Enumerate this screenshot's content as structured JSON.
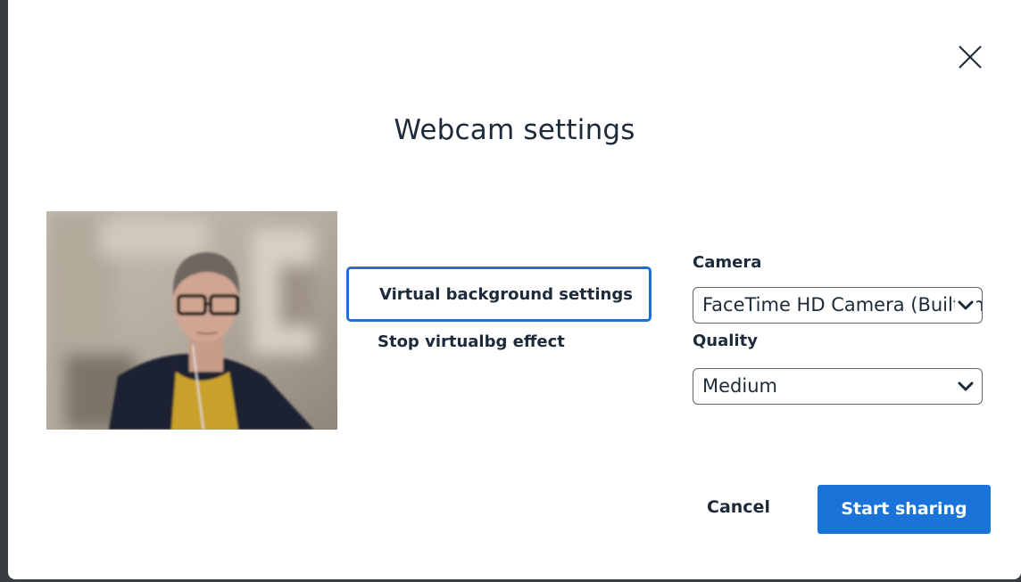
{
  "dialog": {
    "title": "Webcam settings",
    "close_icon": "close-icon"
  },
  "preview": {
    "description_icon": "webcam-preview"
  },
  "menu": {
    "items": [
      {
        "label": "Virtual background settings",
        "active": true
      },
      {
        "label": "Stop virtualbg effect",
        "active": false
      }
    ]
  },
  "camera": {
    "label": "Camera",
    "selected": "FaceTime HD Camera (Built-in)"
  },
  "quality": {
    "label": "Quality",
    "selected": "Medium"
  },
  "actions": {
    "cancel_label": "Cancel",
    "submit_label": "Start sharing"
  },
  "colors": {
    "accent": "#1a73d9",
    "text": "#1d2a3a",
    "border": "#5f6670",
    "background": "#ffffff"
  }
}
